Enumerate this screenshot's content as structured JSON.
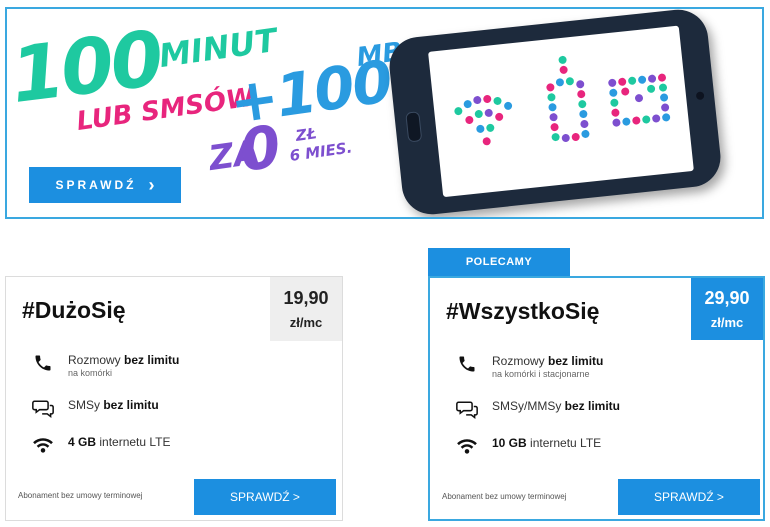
{
  "banner": {
    "promo": {
      "big_number": "100",
      "minutes": "MINUT",
      "or_sms": "LUB SMSÓW",
      "plus_data": "+100",
      "data_unit": "MB",
      "for": "ZA",
      "price": "0",
      "currency": "ZŁ",
      "period": "6 MIES."
    },
    "cta_label": "SPRAWDŹ",
    "cta_chevron": "›",
    "colors": {
      "teal": "#1ec9a0",
      "pink": "#e8257d",
      "blue": "#2a9be0",
      "purple": "#7d4fcf",
      "accent": "#1c8fe0"
    }
  },
  "plans": [
    {
      "title": "#DużoSię",
      "price": "19,90",
      "price_unit": "zł/mc",
      "features": [
        {
          "icon": "phone-icon",
          "pre": "Rozmowy ",
          "bold": "bez limitu",
          "post": "",
          "sub": "na komórki"
        },
        {
          "icon": "chat-icon",
          "pre": "SMSy ",
          "bold": "bez limitu",
          "post": "",
          "sub": ""
        },
        {
          "icon": "wifi-icon",
          "pre": "",
          "bold": "4 GB",
          "post": " internetu LTE",
          "sub": ""
        }
      ],
      "note": "Abonament bez umowy terminowej",
      "cta_label": "SPRAWDŹ >"
    },
    {
      "ribbon": "POLECAMY",
      "title": "#WszystkoSię",
      "price": "29,90",
      "price_unit": "zł/mc",
      "features": [
        {
          "icon": "phone-icon",
          "pre": "Rozmowy ",
          "bold": "bez limitu",
          "post": "",
          "sub": "na komórki i stacjonarne"
        },
        {
          "icon": "chat-icon",
          "pre": "SMSy/MMSy ",
          "bold": "bez limitu",
          "post": "",
          "sub": ""
        },
        {
          "icon": "wifi-icon",
          "pre": "",
          "bold": "10 GB",
          "post": " internetu LTE",
          "sub": ""
        }
      ],
      "note": "Abonament bez umowy terminowej",
      "cta_label": "SPRAWDŹ >"
    }
  ]
}
